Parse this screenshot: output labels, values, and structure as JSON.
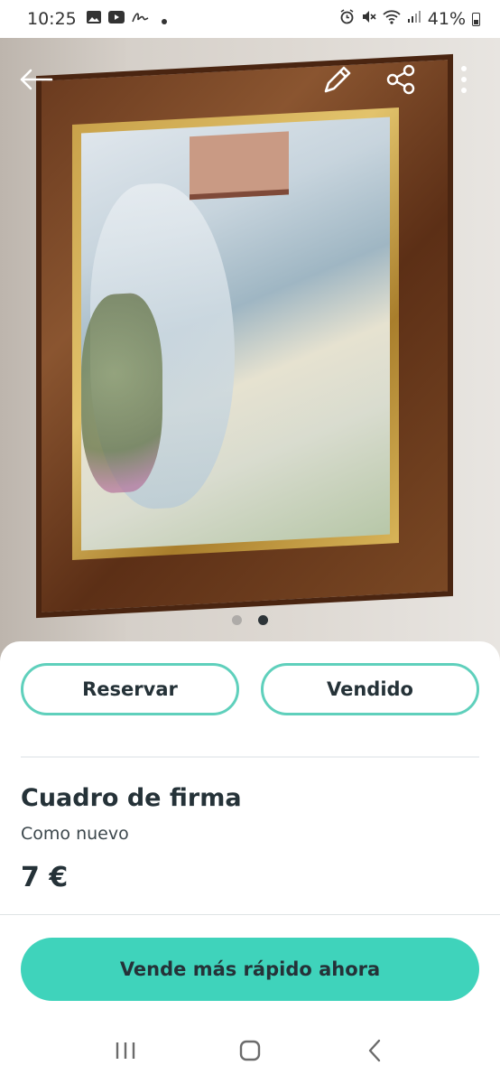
{
  "status_bar": {
    "time": "10:25",
    "battery": "41%",
    "icons_left": [
      "gallery-icon",
      "youtube-icon",
      "signature-icon",
      "dot-icon"
    ],
    "icons_right": [
      "alarm-icon",
      "mute-icon",
      "wifi-icon",
      "signal-icon",
      "battery-icon"
    ]
  },
  "hero": {
    "image_page_total": 2,
    "image_page_current": 2,
    "icons": [
      "back-arrow-icon",
      "edit-pencil-icon",
      "share-icon",
      "more-vert-icon"
    ]
  },
  "actions": {
    "reserve_label": "Reservar",
    "sold_label": "Vendido"
  },
  "item": {
    "title": "Cuadro de firma",
    "condition": "Como nuevo",
    "price": "7 €"
  },
  "promote": {
    "label": "Vende más rápido ahora"
  },
  "colors": {
    "accent": "#3fd3bb",
    "outline": "#5fd0bc",
    "text": "#253238"
  },
  "navbar": {
    "icons": [
      "recents-icon",
      "home-icon",
      "back-icon"
    ]
  }
}
